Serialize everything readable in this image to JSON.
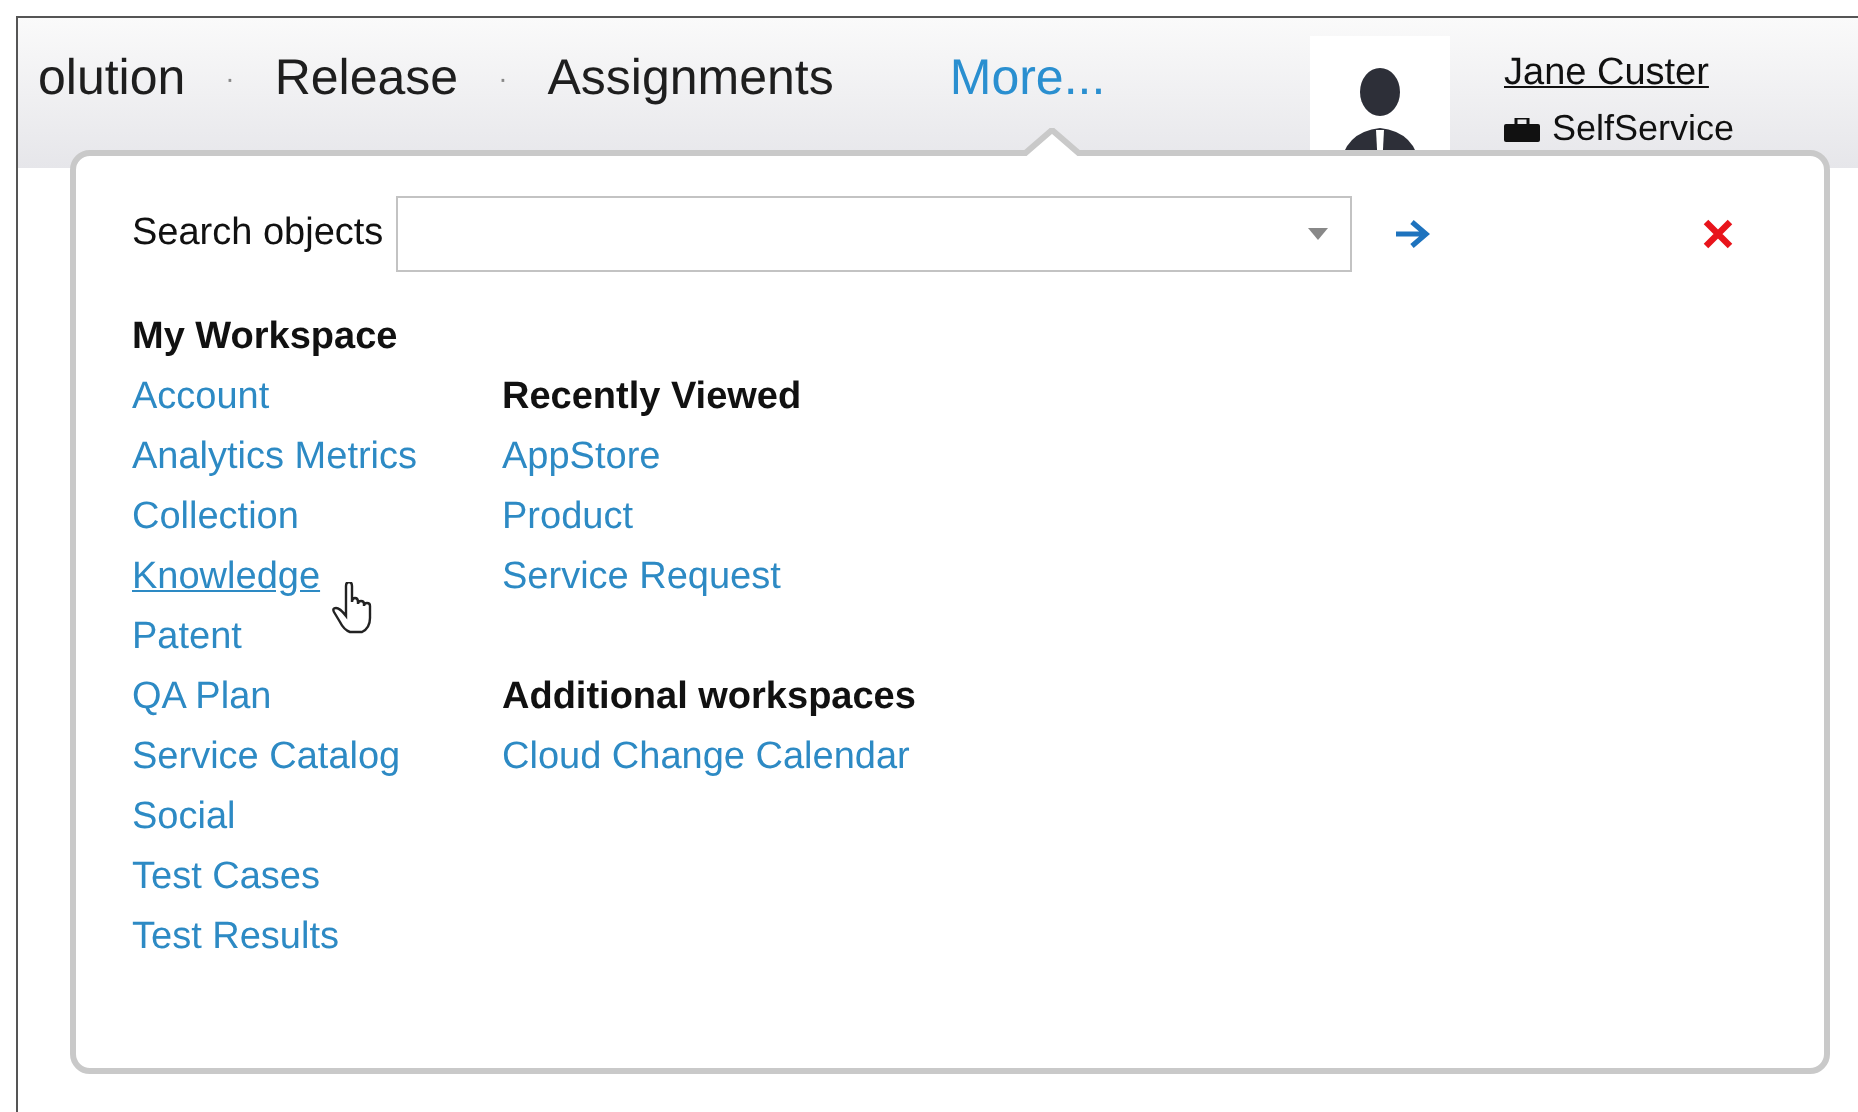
{
  "nav": {
    "items": [
      {
        "kind": "tab",
        "label": "olution",
        "selected": false
      },
      {
        "kind": "separator",
        "label": "·"
      },
      {
        "kind": "tab",
        "label": "Release",
        "selected": false
      },
      {
        "kind": "separator",
        "label": "·"
      },
      {
        "kind": "tab",
        "label": "Assignments",
        "selected": false
      },
      {
        "kind": "tab",
        "label": "More...",
        "selected": true
      }
    ]
  },
  "user": {
    "name": "Jane Custer",
    "role": "SelfService"
  },
  "popup": {
    "search": {
      "label": "Search objects"
    },
    "my_workspace": {
      "title": "My Workspace",
      "items": [
        {
          "label": "Account",
          "hovered": false
        },
        {
          "label": "Analytics Metrics",
          "hovered": false
        },
        {
          "label": "Collection",
          "hovered": false
        },
        {
          "label": "Knowledge",
          "hovered": true
        },
        {
          "label": "Patent",
          "hovered": false
        },
        {
          "label": "QA Plan",
          "hovered": false
        },
        {
          "label": "Service Catalog",
          "hovered": false
        },
        {
          "label": "Social",
          "hovered": false
        },
        {
          "label": "Test Cases",
          "hovered": false
        },
        {
          "label": "Test Results",
          "hovered": false
        }
      ]
    },
    "recently_viewed": {
      "title": "Recently Viewed",
      "items": [
        "AppStore",
        "Product",
        "Service Request"
      ]
    },
    "additional_workspaces": {
      "title": "Additional workspaces",
      "items": [
        "Cloud Change Calendar"
      ]
    }
  }
}
